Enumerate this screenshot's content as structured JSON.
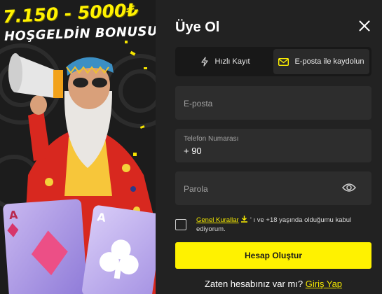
{
  "promo": {
    "amount": "7.150 - 5000₺",
    "title": "HOŞGELDİN BONUSU!"
  },
  "form": {
    "title": "Üye Ol",
    "tabs": [
      {
        "label": "Hızlı Kayıt",
        "icon": "lightning-icon",
        "active": false
      },
      {
        "label": "E-posta ile kaydolun",
        "icon": "envelope-icon",
        "active": true
      }
    ],
    "email": {
      "placeholder": "E-posta"
    },
    "phone": {
      "label": "Telefon Numarası",
      "value": "+ 90"
    },
    "password": {
      "placeholder": "Parola"
    },
    "terms": {
      "link": "Genel Kurallar",
      "text": "' ı ve +18 yaşında olduğumu kabul ediyorum."
    },
    "submit_label": "Hesap Oluştur",
    "login_prompt": "Zaten hesabınız var mı?",
    "login_link": "Giriş Yap"
  },
  "colors": {
    "accent": "#fff200",
    "panel": "#222222",
    "field": "#2d2d2d"
  }
}
